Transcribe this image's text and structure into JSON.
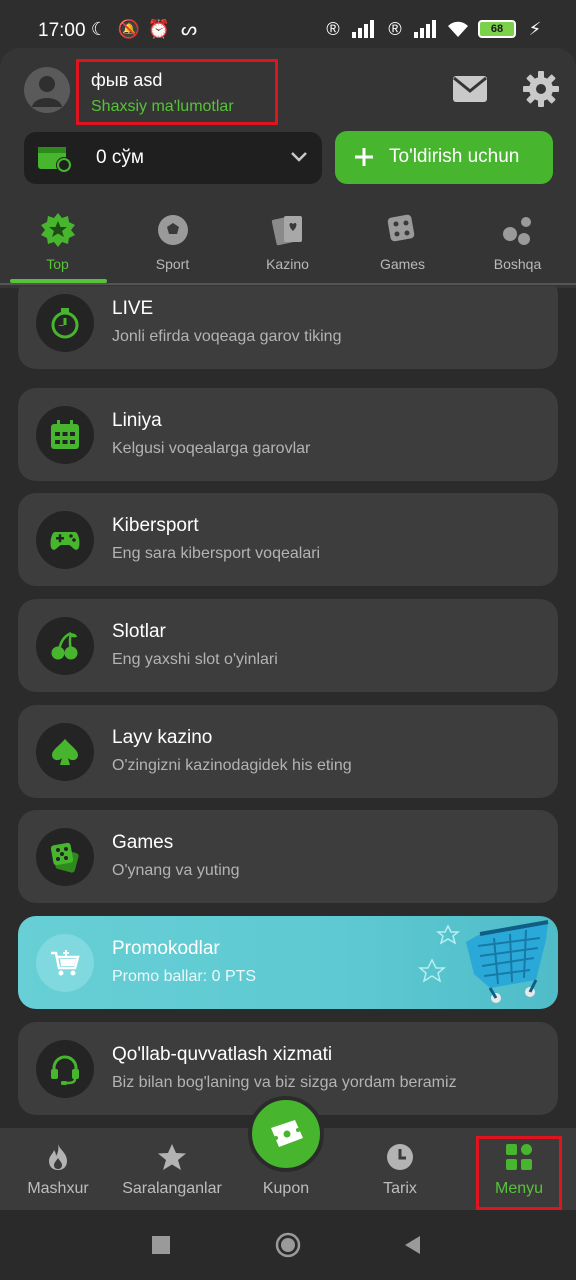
{
  "status_bar": {
    "time": "17:00",
    "battery": "68"
  },
  "profile": {
    "username": "фыв asd",
    "link_label": "Shaxsiy ma'lumotlar"
  },
  "balance": {
    "amount": "0 сўм"
  },
  "topup": {
    "label": "To'ldirish uchun"
  },
  "tabs": [
    {
      "label": "Top",
      "icon": "star-badge-icon",
      "active": true
    },
    {
      "label": "Sport",
      "icon": "soccer-ball-icon"
    },
    {
      "label": "Kazino",
      "icon": "cards-icon"
    },
    {
      "label": "Games",
      "icon": "dice-icon"
    },
    {
      "label": "Boshqa",
      "icon": "dots-icon"
    }
  ],
  "menu_items": [
    {
      "title": "LIVE",
      "subtitle": "Jonli efirda voqeaga garov tiking",
      "icon": "stopwatch-icon"
    },
    {
      "title": "Liniya",
      "subtitle": "Kelgusi voqealarga garovlar",
      "icon": "calendar-icon"
    },
    {
      "title": "Kibersport",
      "subtitle": "Eng sara kibersport voqealari",
      "icon": "gamepad-icon"
    },
    {
      "title": "Slotlar",
      "subtitle": "Eng yaxshi slot o'yinlari",
      "icon": "cherries-icon"
    },
    {
      "title": "Layv kazino",
      "subtitle": "O'zingizni kazinodagidek his eting",
      "icon": "spade-icon"
    },
    {
      "title": "Games",
      "subtitle": "O'ynang va yuting",
      "icon": "dice-icon"
    },
    {
      "title": "Promokodlar",
      "subtitle": "Promo ballar: 0 PTS",
      "icon": "cart-icon"
    },
    {
      "title": "Qo'llab-quvvatlash xizmati",
      "subtitle": "Biz bilan bog'laning va biz sizga yordam beramiz",
      "icon": "headset-icon"
    }
  ],
  "bottom_nav": [
    {
      "label": "Mashxur",
      "icon": "flame-icon"
    },
    {
      "label": "Saralanganlar",
      "icon": "star-icon"
    },
    {
      "label": "Kupon",
      "icon": "ticket-icon"
    },
    {
      "label": "Tarix",
      "icon": "clock-icon"
    },
    {
      "label": "Menyu",
      "icon": "grid-icon",
      "active": true
    }
  ],
  "colors": {
    "accent": "#57c23a",
    "button": "#47b62e",
    "highlight": "#e0141e",
    "promo": "#5ec9d2"
  }
}
